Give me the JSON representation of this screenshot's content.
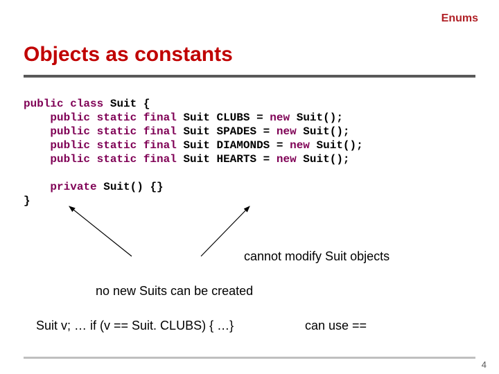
{
  "header": {
    "topic": "Enums"
  },
  "title": "Objects as constants",
  "code": {
    "l1": {
      "kw1": "public",
      "kw2": "class",
      "name": "Suit",
      "brace": "{"
    },
    "field_lines": [
      {
        "mods": "public static final",
        "type": "Suit",
        "name": "CLUBS",
        "rest": " = ",
        "kw_new": "new",
        "tail": " Suit();"
      },
      {
        "mods": "public static final",
        "type": "Suit",
        "name": "SPADES",
        "rest": " = ",
        "kw_new": "new",
        "tail": " Suit();"
      },
      {
        "mods": "public static final",
        "type": "Suit",
        "name": "DIAMONDS",
        "rest": " = ",
        "kw_new": "new",
        "tail": " Suit();"
      },
      {
        "mods": "public static final",
        "type": "Suit",
        "name": "HEARTS",
        "rest": " = ",
        "kw_new": "new",
        "tail": " Suit();"
      }
    ],
    "ctor": {
      "kw": "private",
      "rest": " Suit() {}"
    },
    "close": "}"
  },
  "notes": {
    "cannot_modify": "cannot modify Suit objects",
    "no_new": "no new Suits can be created",
    "usage": "Suit v;  …  if (v == Suit. CLUBS) { …}",
    "can_eq": "can use =="
  },
  "page": "4"
}
